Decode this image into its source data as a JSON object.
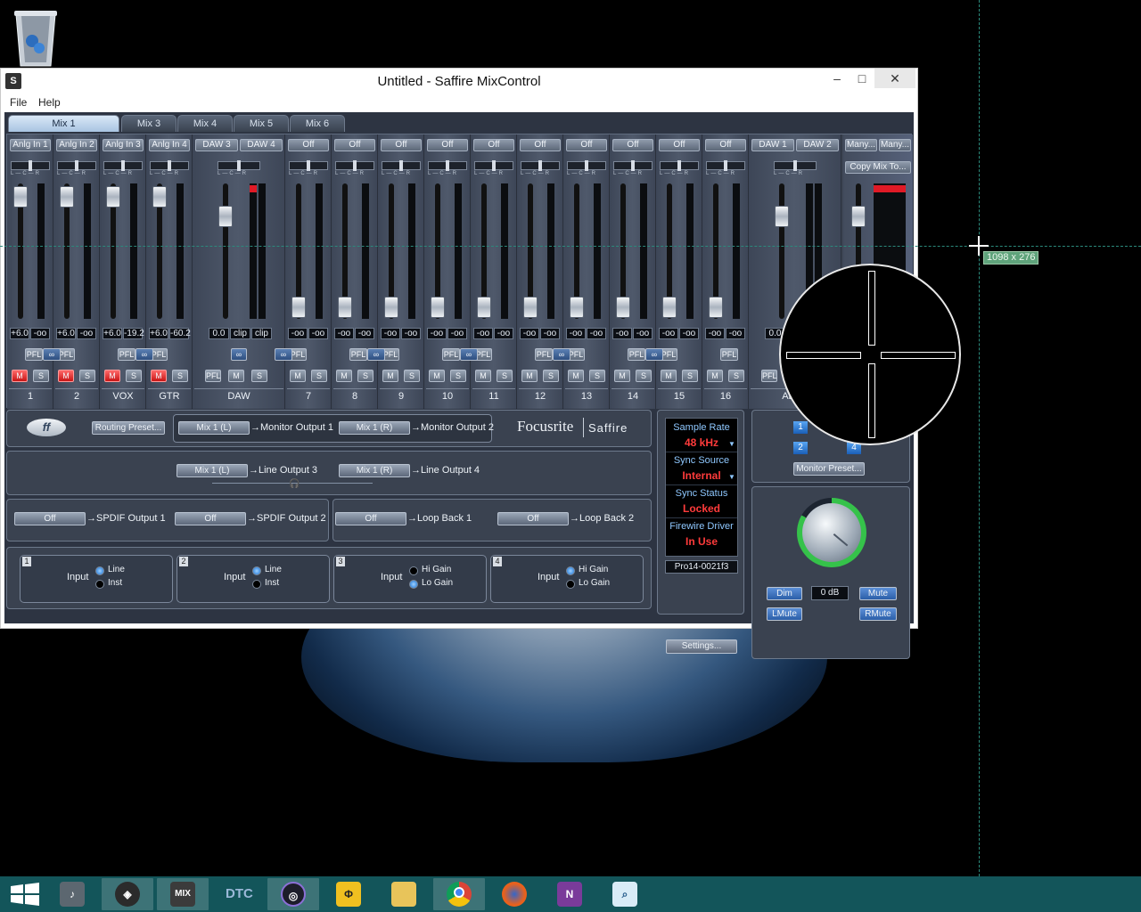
{
  "window": {
    "title": "Untitled - Saffire MixControl",
    "app_icon": "S",
    "minimize": "–",
    "maximize": "□",
    "close": "✕"
  },
  "menu": [
    "File",
    "Help"
  ],
  "tabs": [
    "Mix 1",
    "Mix 3",
    "Mix 4",
    "Mix 5",
    "Mix 6"
  ],
  "strips": [
    {
      "source": "Anlg In 1",
      "values": [
        "+6.0",
        "-oo"
      ],
      "name": "1",
      "mute_on": true
    },
    {
      "source": "Anlg In 2",
      "values": [
        "+6.0",
        "-oo"
      ],
      "name": "2",
      "mute_on": true
    },
    {
      "source": "Anlg In 3",
      "values": [
        "+6.0",
        "-19.2"
      ],
      "name": "VOX",
      "mute_on": true
    },
    {
      "source": "Anlg In 4",
      "values": [
        "+6.0",
        "-60.2"
      ],
      "name": "GTR",
      "mute_on": true
    },
    {
      "source": "DAW 3",
      "source2": "DAW 4",
      "values": [
        "0.0",
        "clip",
        "clip"
      ],
      "name": "DAW",
      "mute_on": false
    },
    {
      "source": "Off",
      "values": [
        "-oo",
        "-oo"
      ],
      "name": "7"
    },
    {
      "source": "Off",
      "values": [
        "-oo",
        "-oo"
      ],
      "name": "8"
    },
    {
      "source": "Off",
      "values": [
        "-oo",
        "-oo"
      ],
      "name": "9"
    },
    {
      "source": "Off",
      "values": [
        "-oo",
        "-oo"
      ],
      "name": "10"
    },
    {
      "source": "Off",
      "values": [
        "-oo",
        "-oo"
      ],
      "name": "11"
    },
    {
      "source": "Off",
      "values": [
        "-oo",
        "-oo"
      ],
      "name": "12"
    },
    {
      "source": "Off",
      "values": [
        "-oo",
        "-oo"
      ],
      "name": "13"
    },
    {
      "source": "Off",
      "values": [
        "-oo",
        "-oo"
      ],
      "name": "14"
    },
    {
      "source": "Off",
      "values": [
        "-oo",
        "-oo"
      ],
      "name": "15"
    },
    {
      "source": "Off",
      "values": [
        "-oo",
        "-oo"
      ],
      "name": "16"
    },
    {
      "source": "DAW 1",
      "source2": "DAW 2",
      "values": [
        "0.0"
      ],
      "name": "ALL S"
    }
  ],
  "strip_buttons": {
    "pfl": "PFL",
    "mute": "M",
    "solo": "S"
  },
  "master": {
    "many1": "Many...",
    "many2": "Many...",
    "copy": "Copy Mix To..."
  },
  "routing": {
    "logo_alt": "ff",
    "preset": "Routing Preset...",
    "brand": "Focusrite",
    "brand2": "Saffire",
    "rows": [
      {
        "src": "Mix 1 (L)",
        "dst": "Monitor Output 1"
      },
      {
        "src": "Mix 1 (R)",
        "dst": "Monitor Output 2"
      },
      {
        "src": "Mix 1 (L)",
        "dst": "Line Output 3"
      },
      {
        "src": "Mix 1 (R)",
        "dst": "Line Output 4"
      },
      {
        "src": "Off",
        "dst": "SPDIF Output 1"
      },
      {
        "src": "Off",
        "dst": "SPDIF Output 2"
      },
      {
        "src": "Off",
        "dst": "Loop Back 1"
      },
      {
        "src": "Off",
        "dst": "Loop Back 2"
      }
    ]
  },
  "inputs": [
    {
      "num": "1",
      "label": "Input",
      "opt1": "Line",
      "opt2": "Inst",
      "sel": 1
    },
    {
      "num": "2",
      "label": "Input",
      "opt1": "Line",
      "opt2": "Inst",
      "sel": 1
    },
    {
      "num": "3",
      "label": "Input",
      "opt1": "Hi Gain",
      "opt2": "Lo Gain",
      "sel": 2
    },
    {
      "num": "4",
      "label": "Input",
      "opt1": "Hi Gain",
      "opt2": "Lo Gain",
      "sel": 1
    }
  ],
  "status": {
    "sample_rate_label": "Sample Rate",
    "sample_rate": "48 kHz",
    "sync_source_label": "Sync Source",
    "sync_source": "Internal",
    "sync_status_label": "Sync Status",
    "sync_status": "Locked",
    "firewire_label": "Firewire Driver",
    "firewire": "In Use",
    "device": "Pro14-0021f3",
    "settings": "Settings..."
  },
  "monitor": {
    "b1": "1",
    "b2": "2",
    "b4": "4",
    "preset": "Monitor Preset...",
    "dim": "Dim",
    "level": "0 dB",
    "mute": "Mute",
    "lmute": "LMute",
    "rmute": "RMute"
  },
  "overlay": {
    "coords": "1098 x 276"
  },
  "taskbar": [
    "start-icon",
    "media-icon",
    "foobar-icon",
    "mixcontrol-icon",
    "dtc-icon",
    "protools-icon",
    "app-icon",
    "explorer-icon",
    "chrome-icon",
    "firefox-icon",
    "onenote-icon",
    "search-icon"
  ],
  "taskbar_text": {
    "mix": "MIX",
    "dtc": "DTC",
    "onenote": "N"
  }
}
